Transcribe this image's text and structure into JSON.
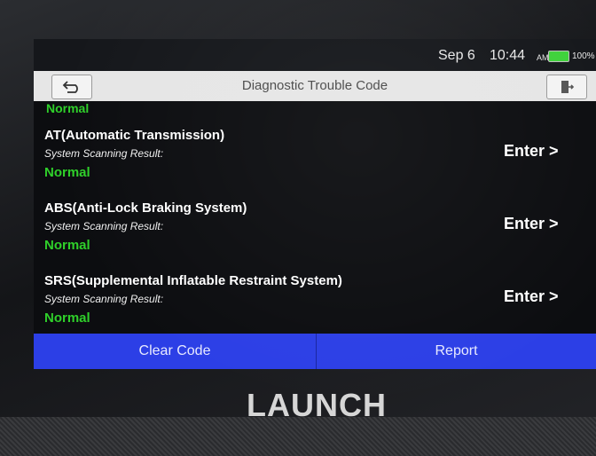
{
  "status_bar": {
    "date": "Sep 6",
    "time": "10:44",
    "ampm": "AM",
    "battery_percent": "100%",
    "battery_color": "#3ed13a"
  },
  "header": {
    "title": "Diagnostic Trouble Code",
    "back_icon": "back-arrow-icon",
    "exit_icon": "exit-door-icon"
  },
  "list": {
    "top_status": "Normal",
    "items": [
      {
        "name": "AT(Automatic Transmission)",
        "result_label": "System Scanning Result:",
        "result": "Normal",
        "action": "Enter >"
      },
      {
        "name": "ABS(Anti-Lock Braking System)",
        "result_label": "System Scanning Result:",
        "result": "Normal",
        "action": "Enter >"
      },
      {
        "name": "SRS(Supplemental Inflatable Restraint System)",
        "result_label": "System Scanning Result:",
        "result": "Normal",
        "action": "Enter >"
      }
    ]
  },
  "footer": {
    "clear_label": "Clear Code",
    "report_label": "Report",
    "accent_color": "#2c3fe6"
  },
  "device": {
    "brand": "LAUNCH"
  }
}
